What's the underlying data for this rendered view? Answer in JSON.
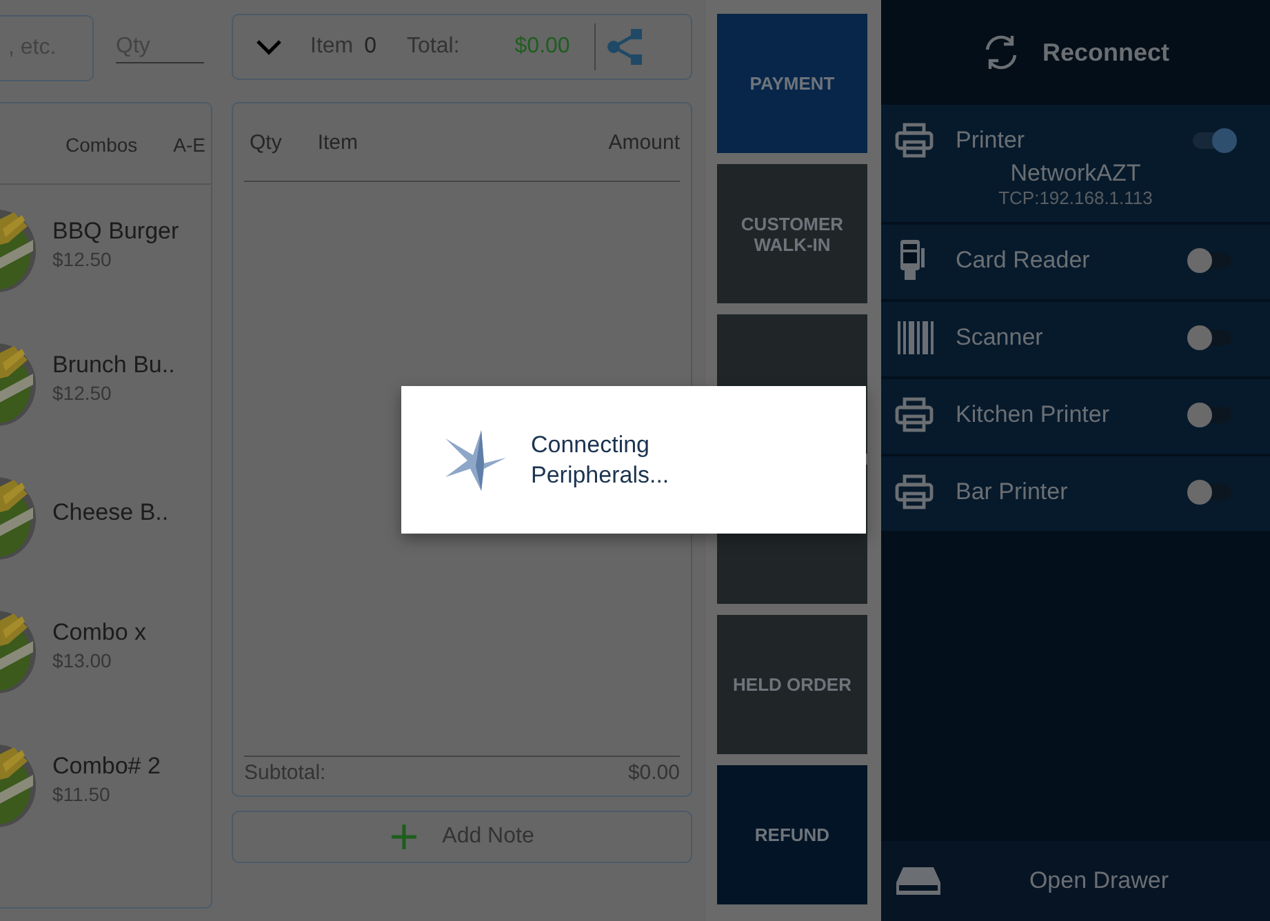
{
  "search": {
    "placeholder": ", etc."
  },
  "qty": {
    "placeholder": "Qty"
  },
  "order_bar": {
    "item_label": "Item",
    "item_count": "0",
    "total_label": "Total:",
    "total": "$0.00"
  },
  "categories": [
    {
      "label": "Combos",
      "selected": false
    },
    {
      "label": "A-E",
      "selected": false
    }
  ],
  "products": [
    {
      "name": "BBQ Burger",
      "price": "$12.50"
    },
    {
      "name": "Brunch Bu..",
      "price": "$12.50"
    },
    {
      "name": "Cheese B.."
    },
    {
      "name": "Combo x",
      "price": "$13.00"
    },
    {
      "name": "Combo# 2",
      "price": "$11.50"
    }
  ],
  "order_table": {
    "columns": [
      "Qty",
      "Item",
      "Amount"
    ],
    "subtotal_label": "Subtotal:",
    "subtotal": "$0.00"
  },
  "add_note": "Add Note",
  "actions": [
    {
      "label": "PAYMENT",
      "kind": "primary"
    },
    {
      "label": "CUSTOMER WALK-IN",
      "kind": "normal"
    },
    {
      "kind": "normal"
    },
    {
      "kind": "normal"
    },
    {
      "label": "HELD ORDER",
      "kind": "normal"
    },
    {
      "label": "REFUND",
      "kind": "dark"
    }
  ],
  "peripherals": {
    "reconnect": "Reconnect",
    "devices": [
      {
        "kind": "printer",
        "name": "Printer",
        "on": true,
        "detail": "NetworkAZT",
        "address": "TCP:192.168.1.113"
      },
      {
        "kind": "card_reader",
        "name": "Card Reader",
        "on": false
      },
      {
        "kind": "scanner",
        "name": "Scanner",
        "on": false
      },
      {
        "kind": "printer",
        "name": "Kitchen Printer",
        "on": false
      },
      {
        "kind": "printer",
        "name": "Bar Printer",
        "on": false
      }
    ],
    "open_drawer": "Open Drawer"
  },
  "dialog": {
    "message": "Connecting Peripherals..."
  }
}
